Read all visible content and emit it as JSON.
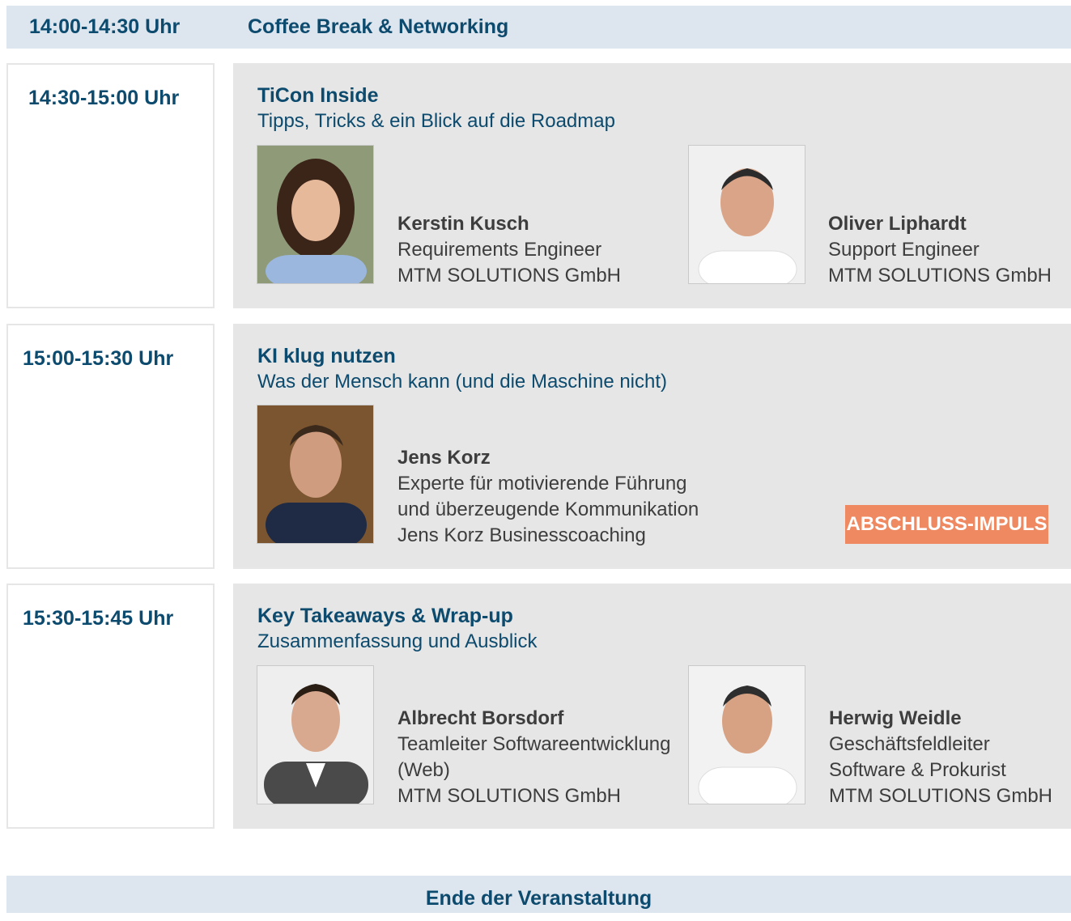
{
  "coffee_break": {
    "time": "14:00-14:30 Uhr",
    "label": "Coffee Break & Networking"
  },
  "sessions": [
    {
      "time": "14:30-15:00 Uhr",
      "title": "TiCon Inside",
      "subtitle": "Tipps, Tricks & ein Blick auf die Roadmap",
      "speakers": [
        {
          "name": "Kerstin Kusch",
          "lines": [
            "Requirements Engineer",
            "MTM SOLUTIONS GmbH"
          ]
        },
        {
          "name": "Oliver Liphardt",
          "lines": [
            "Support Engineer",
            "MTM SOLUTIONS GmbH"
          ]
        }
      ]
    },
    {
      "time": "15:00-15:30 Uhr",
      "title": "KI klug nutzen",
      "subtitle": "Was der Mensch kann (und die Maschine nicht)",
      "badge": "ABSCHLUSS-IMPULS",
      "speakers": [
        {
          "name": "Jens Korz",
          "lines": [
            "Experte für motivierende Führung",
            "und überzeugende Kommunikation",
            "Jens Korz Businesscoaching"
          ]
        }
      ]
    },
    {
      "time": "15:30-15:45 Uhr",
      "title": "Key Takeaways & Wrap-up",
      "subtitle": "Zusammenfassung und Ausblick",
      "speakers": [
        {
          "name": "Albrecht Borsdorf",
          "lines": [
            "Teamleiter Softwareentwicklung",
            "(Web)",
            "MTM SOLUTIONS GmbH"
          ]
        },
        {
          "name": "Herwig Weidle",
          "lines": [
            "Geschäftsfeldleiter",
            "Software & Prokurist",
            "MTM SOLUTIONS GmbH"
          ]
        }
      ]
    }
  ],
  "end_label": "Ende der Veranstaltung",
  "colors": {
    "heading": "#0c4a6e",
    "band": "#dde5ee",
    "panel": "#e6e6e6",
    "badge": "#ef8961",
    "text": "#3d3d3d"
  }
}
